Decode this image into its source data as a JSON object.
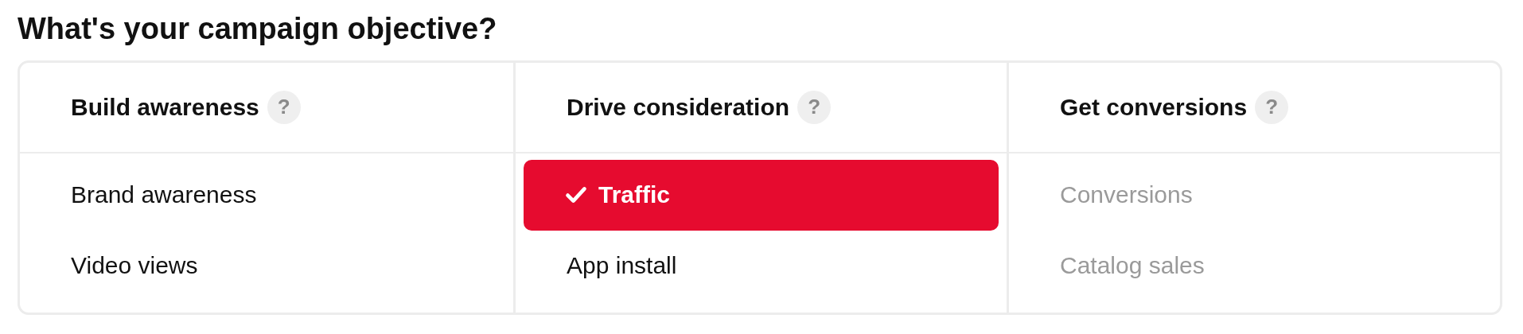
{
  "title": "What's your campaign objective?",
  "columns": [
    {
      "heading": "Build awareness",
      "help": "?",
      "options": [
        {
          "label": "Brand awareness",
          "selected": false,
          "disabled": false
        },
        {
          "label": "Video views",
          "selected": false,
          "disabled": false
        }
      ]
    },
    {
      "heading": "Drive consideration",
      "help": "?",
      "options": [
        {
          "label": "Traffic",
          "selected": true,
          "disabled": false
        },
        {
          "label": "App install",
          "selected": false,
          "disabled": false
        }
      ]
    },
    {
      "heading": "Get conversions",
      "help": "?",
      "options": [
        {
          "label": "Conversions",
          "selected": false,
          "disabled": true
        },
        {
          "label": "Catalog sales",
          "selected": false,
          "disabled": true
        }
      ]
    }
  ]
}
